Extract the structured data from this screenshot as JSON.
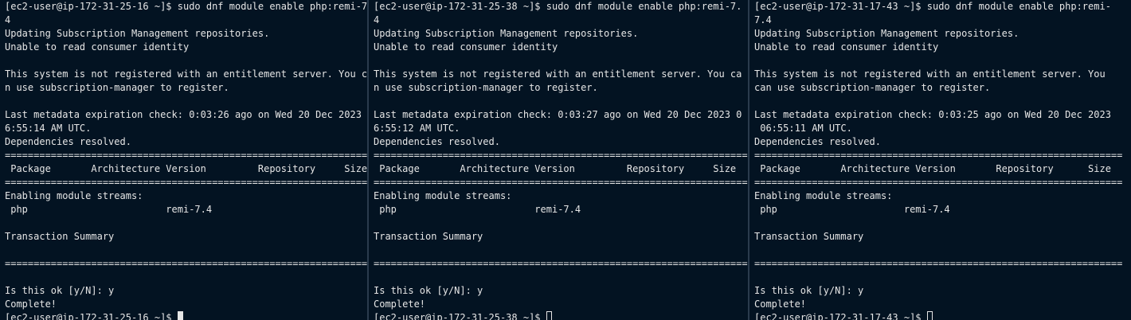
{
  "terminals": [
    {
      "lines": [
        "[ec2-user@ip-172-31-25-16 ~]$ sudo dnf module enable php:remi-7.",
        "4",
        "Updating Subscription Management repositories.",
        "Unable to read consumer identity",
        "",
        "This system is not registered with an entitlement server. You ca",
        "n use subscription-manager to register.",
        "",
        "Last metadata expiration check: 0:03:26 ago on Wed 20 Dec 2023 0",
        "6:55:14 AM UTC.",
        "Dependencies resolved.",
        "=================================================================",
        " Package       Architecture Version         Repository     Size",
        "=================================================================",
        "Enabling module streams:",
        " php                        remi-7.4",
        "",
        "Transaction Summary",
        "",
        "=================================================================",
        "",
        "Is this ok [y/N]: y",
        "Complete!"
      ],
      "prompt": "[ec2-user@ip-172-31-25-16 ~]$ ",
      "cursor": "solid"
    },
    {
      "lines": [
        "[ec2-user@ip-172-31-25-38 ~]$ sudo dnf module enable php:remi-7.",
        "4",
        "Updating Subscription Management repositories.",
        "Unable to read consumer identity",
        "",
        "This system is not registered with an entitlement server. You ca",
        "n use subscription-manager to register.",
        "",
        "Last metadata expiration check: 0:03:27 ago on Wed 20 Dec 2023 0",
        "6:55:12 AM UTC.",
        "Dependencies resolved.",
        "=================================================================",
        " Package       Architecture Version         Repository     Size",
        "=================================================================",
        "Enabling module streams:",
        " php                        remi-7.4",
        "",
        "Transaction Summary",
        "",
        "=================================================================",
        "",
        "Is this ok [y/N]: y",
        "Complete!"
      ],
      "prompt": "[ec2-user@ip-172-31-25-38 ~]$ ",
      "cursor": "hollow"
    },
    {
      "lines": [
        "[ec2-user@ip-172-31-17-43 ~]$ sudo dnf module enable php:remi-",
        "7.4",
        "Updating Subscription Management repositories.",
        "Unable to read consumer identity",
        "",
        "This system is not registered with an entitlement server. You",
        "can use subscription-manager to register.",
        "",
        "Last metadata expiration check: 0:03:25 ago on Wed 20 Dec 2023",
        " 06:55:11 AM UTC.",
        "Dependencies resolved.",
        "================================================================",
        " Package       Architecture Version       Repository      Size",
        "================================================================",
        "Enabling module streams:",
        " php                      remi-7.4",
        "",
        "Transaction Summary",
        "",
        "================================================================",
        "",
        "Is this ok [y/N]: y",
        "Complete!"
      ],
      "prompt": "[ec2-user@ip-172-31-17-43 ~]$ ",
      "cursor": "hollow"
    }
  ]
}
